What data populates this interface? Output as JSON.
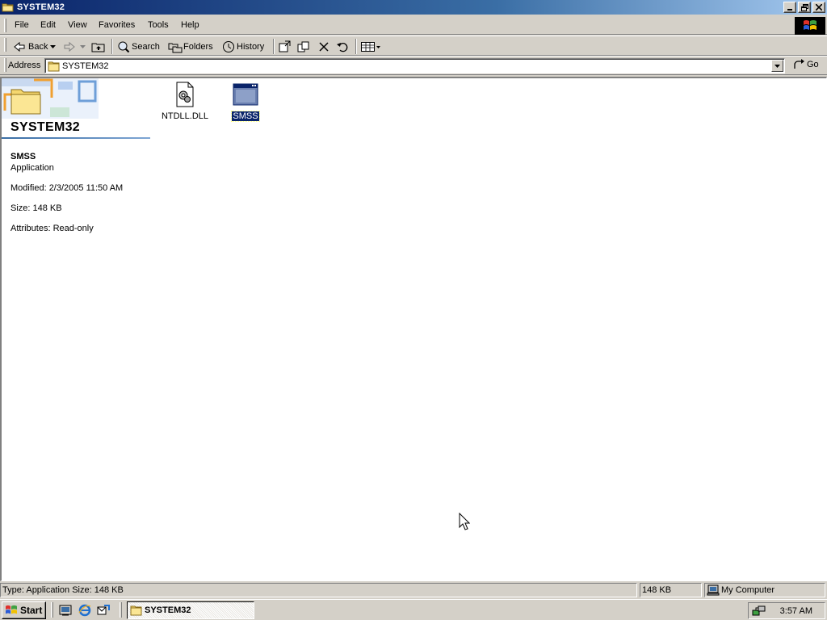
{
  "window": {
    "title": "SYSTEM32",
    "controls": [
      "minimize",
      "maximize",
      "close"
    ]
  },
  "menu": {
    "items": [
      "File",
      "Edit",
      "View",
      "Favorites",
      "Tools",
      "Help"
    ]
  },
  "toolbar": {
    "back_label": "Back",
    "search_label": "Search",
    "folders_label": "Folders",
    "history_label": "History"
  },
  "address": {
    "label": "Address",
    "value": "SYSTEM32",
    "go_label": "Go"
  },
  "sidebar": {
    "folder_title": "SYSTEM32",
    "selected_name": "SMSS",
    "selected_type": "Application",
    "modified": "Modified: 2/3/2005 11:50 AM",
    "size": "Size: 148 KB",
    "attributes": "Attributes: Read-only"
  },
  "files": [
    {
      "name": "NTDLL.DLL",
      "icon": "dll-file-icon",
      "selected": false
    },
    {
      "name": "SMSS",
      "icon": "application-icon",
      "selected": true
    }
  ],
  "status": {
    "info": "Type: Application Size: 148 KB",
    "size": "148 KB",
    "zone": "My Computer"
  },
  "taskbar": {
    "start_label": "Start",
    "task_label": "SYSTEM32",
    "clock": "3:57 AM"
  },
  "colors": {
    "title_active": "#0a246a",
    "chrome": "#d4d0c8",
    "selection": "#0a246a"
  }
}
